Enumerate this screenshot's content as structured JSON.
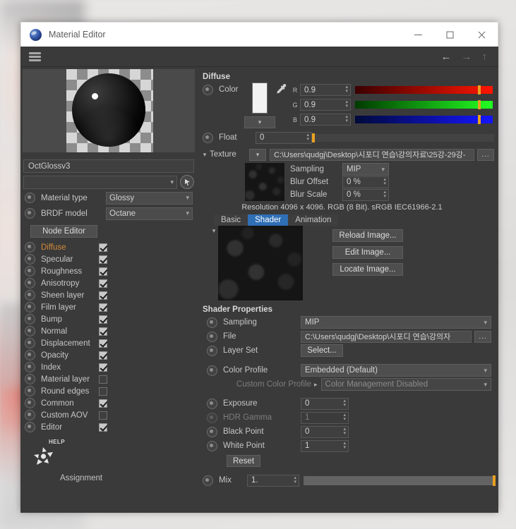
{
  "window": {
    "title": "Material Editor",
    "icon": "octane-orb-icon",
    "controls": {
      "minimize": "—",
      "maximize": "□",
      "close": "✕"
    },
    "toolbar": {
      "menu_icon": "hamburger-icon",
      "back": "←",
      "forward": "→",
      "up": "↑"
    }
  },
  "left": {
    "preview_alt": "material-preview-sphere",
    "material_name": "OctGlossv3",
    "search_value": "",
    "properties": [
      {
        "label": "Material type",
        "value": "Glossy"
      },
      {
        "label": "BRDF model",
        "value": "Octane"
      }
    ],
    "node_editor_button": "Node Editor",
    "channels": [
      {
        "label": "Diffuse",
        "checked": true,
        "active": true
      },
      {
        "label": "Specular",
        "checked": true,
        "active": false
      },
      {
        "label": "Roughness",
        "checked": true,
        "active": false
      },
      {
        "label": "Anisotropy",
        "checked": true,
        "active": false
      },
      {
        "label": "Sheen layer",
        "checked": true,
        "active": false
      },
      {
        "label": "Film layer",
        "checked": true,
        "active": false
      },
      {
        "label": "Bump",
        "checked": true,
        "active": false
      },
      {
        "label": "Normal",
        "checked": true,
        "active": false
      },
      {
        "label": "Displacement",
        "checked": true,
        "active": false
      },
      {
        "label": "Opacity",
        "checked": true,
        "active": false
      },
      {
        "label": "Index",
        "checked": true,
        "active": false
      },
      {
        "label": "Material layer",
        "checked": false,
        "active": false
      },
      {
        "label": "Round edges",
        "checked": false,
        "active": false
      },
      {
        "label": "Common",
        "checked": true,
        "active": false
      },
      {
        "label": "Custom AOV",
        "checked": false,
        "active": false
      },
      {
        "label": "Editor",
        "checked": true,
        "active": false
      }
    ],
    "help_label": "HELP",
    "assignment_label": "Assignment"
  },
  "diffuse": {
    "section_title": "Diffuse",
    "color_label": "Color",
    "swatch_hex": "#f2f2f2",
    "eyedropper_icon": "eyedropper-icon",
    "mode_combo": "",
    "channels": [
      {
        "name": "R",
        "value": "0.9",
        "slider_pct": 90,
        "from": "#3a0000",
        "to": "#ff1500"
      },
      {
        "name": "G",
        "value": "0.9",
        "slider_pct": 90,
        "from": "#003a00",
        "to": "#22ff22"
      },
      {
        "name": "B",
        "value": "0.9",
        "slider_pct": 90,
        "from": "#000a3a",
        "to": "#1515ff"
      }
    ],
    "float_label": "Float",
    "float_value": "0",
    "float_pct": 0
  },
  "texture": {
    "label": "Texture",
    "path": "C:\\Users\\qudgj\\Desktop\\시포디 연습\\강의자료\\25강-29강-",
    "browse_label": "...",
    "fields": [
      {
        "label": "Sampling",
        "value": "MIP",
        "type": "combo"
      },
      {
        "label": "Blur Offset",
        "value": "0 %",
        "type": "spin"
      },
      {
        "label": "Blur Scale",
        "value": "0 %",
        "type": "spin"
      }
    ],
    "resolution_info": "Resolution 4096 x 4096. RGB (8 Bit). sRGB IEC61966-2.1",
    "tabs": [
      {
        "label": "Basic",
        "selected": false
      },
      {
        "label": "Shader",
        "selected": true
      },
      {
        "label": "Animation",
        "selected": false
      }
    ],
    "image_buttons": [
      "Reload Image...",
      "Edit Image...",
      "Locate Image..."
    ]
  },
  "shader_properties": {
    "title": "Shader Properties",
    "sampling": {
      "label": "Sampling",
      "value": "MIP"
    },
    "file": {
      "label": "File",
      "value": "C:\\Users\\qudgj\\Desktop\\시포디 연습\\강의자",
      "browse": "..."
    },
    "layer_set": {
      "label": "Layer Set",
      "button": "Select..."
    },
    "color_profile": {
      "label": "Color Profile",
      "value": "Embedded (Default)"
    },
    "custom_color_profile": {
      "label": "Custom Color Profile",
      "value": "Color Management Disabled",
      "disabled": true
    },
    "exposure": {
      "label": "Exposure",
      "value": "0"
    },
    "hdr_gamma": {
      "label": "HDR Gamma",
      "value": "1",
      "disabled": true
    },
    "black_point": {
      "label": "Black Point",
      "value": "0"
    },
    "white_point": {
      "label": "White Point",
      "value": "1"
    },
    "reset_button": "Reset"
  },
  "mix": {
    "label": "Mix",
    "value": "1.",
    "slider_pct": 100
  }
}
